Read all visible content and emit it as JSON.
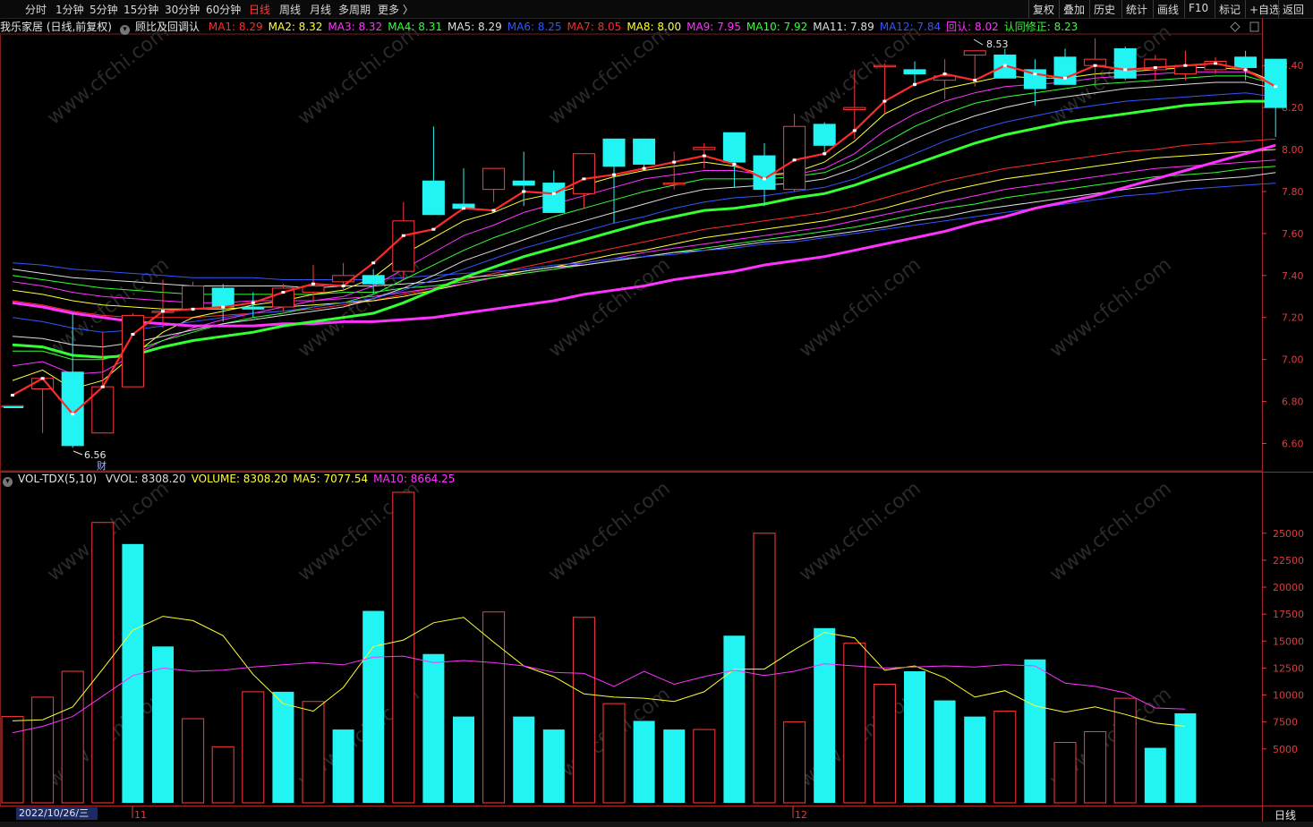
{
  "periods": [
    "分时",
    "1分钟",
    "5分钟",
    "15分钟",
    "30分钟",
    "60分钟",
    "日线",
    "周线",
    "月线",
    "多周期",
    "更多 〉"
  ],
  "active_period": "日线",
  "right_tools": [
    "复权",
    "叠加",
    "历史",
    "统计",
    "画线",
    "F10",
    "标记",
    "+自选",
    "返回"
  ],
  "main_indicator": {
    "stock": "我乐家居 (日线,前复权)",
    "formula": "顾比及回调认",
    "values": [
      {
        "label": "MA1: 8.29",
        "color": "#ff2b2b"
      },
      {
        "label": "MA2: 8.32",
        "color": "#ffff33"
      },
      {
        "label": "MA3: 8.32",
        "color": "#ff33ff"
      },
      {
        "label": "MA4: 8.31",
        "color": "#33ff33"
      },
      {
        "label": "MA5: 8.29",
        "color": "#dddddd"
      },
      {
        "label": "MA6: 8.25",
        "color": "#3355ff"
      },
      {
        "label": "MA7: 8.05",
        "color": "#ff2b2b"
      },
      {
        "label": "MA8: 8.00",
        "color": "#ffff33"
      },
      {
        "label": "MA9: 7.95",
        "color": "#ff33ff"
      },
      {
        "label": "MA10: 7.92",
        "color": "#33ff33"
      },
      {
        "label": "MA11: 7.89",
        "color": "#dddddd"
      },
      {
        "label": "MA12: 7.84",
        "color": "#3355ff"
      },
      {
        "label": "回认: 8.02",
        "color": "#ff33ff"
      },
      {
        "label": "认同修正: 8.23",
        "color": "#33ff33"
      }
    ]
  },
  "vol_indicator": {
    "name": "VOL-TDX(5,10)",
    "values": [
      {
        "label": "VVOL: 8308.20",
        "color": "#dddddd"
      },
      {
        "label": "VOLUME: 8308.20",
        "color": "#ffff33"
      },
      {
        "label": "MA5: 7077.54",
        "color": "#ffff33"
      },
      {
        "label": "MA10: 8664.25",
        "color": "#ff33ff"
      }
    ]
  },
  "annotations": {
    "high_mark": "8.53",
    "low_mark": "6.56",
    "fin_mark": "财"
  },
  "bottom": {
    "date": "2022/10/26/三",
    "month_marks": [
      "11",
      "12"
    ],
    "period": "日线"
  },
  "watermark": "www.cfchi.com",
  "colors": {
    "up": "#ff3b3b",
    "down": "#22f3f3",
    "axis": "#e03c3c"
  },
  "price_axis": [
    "8.40",
    "8.20",
    "8.00",
    "7.80",
    "7.60",
    "7.40",
    "7.20",
    "7.00",
    "6.80",
    "6.60"
  ],
  "vol_axis": [
    "25000",
    "22500",
    "20000",
    "17500",
    "15000",
    "12500",
    "10000",
    "7500",
    "5000"
  ],
  "candles": [
    [
      6.78,
      6.78,
      6.78,
      6.78
    ],
    [
      6.86,
      6.91,
      6.65,
      6.91
    ],
    [
      6.94,
      7.22,
      6.58,
      6.59
    ],
    [
      6.65,
      7.13,
      6.65,
      6.87
    ],
    [
      6.87,
      7.22,
      6.87,
      7.21
    ],
    [
      7.23,
      7.38,
      7.15,
      7.23
    ],
    [
      7.24,
      7.37,
      7.23,
      7.35
    ],
    [
      7.34,
      7.36,
      7.18,
      7.25
    ],
    [
      7.25,
      7.32,
      7.2,
      7.24
    ],
    [
      7.25,
      7.36,
      7.23,
      7.34
    ],
    [
      7.32,
      7.45,
      7.27,
      7.35
    ],
    [
      7.37,
      7.46,
      7.33,
      7.4
    ],
    [
      7.4,
      7.43,
      7.31,
      7.36
    ],
    [
      7.42,
      7.75,
      7.38,
      7.66
    ],
    [
      7.85,
      8.11,
      7.73,
      7.69
    ],
    [
      7.74,
      7.91,
      7.73,
      7.72
    ],
    [
      7.81,
      7.91,
      7.75,
      7.91
    ],
    [
      7.85,
      7.99,
      7.73,
      7.83
    ],
    [
      7.84,
      7.9,
      7.71,
      7.7
    ],
    [
      7.79,
      7.97,
      7.72,
      7.98
    ],
    [
      8.05,
      8.05,
      7.65,
      7.92
    ],
    [
      8.05,
      8.05,
      7.9,
      7.93
    ],
    [
      7.84,
      7.99,
      7.81,
      7.84
    ],
    [
      8.0,
      8.03,
      7.91,
      8.01
    ],
    [
      8.08,
      8.08,
      7.82,
      7.94
    ],
    [
      7.97,
      8.03,
      7.73,
      7.81
    ],
    [
      7.81,
      8.17,
      7.8,
      8.11
    ],
    [
      8.12,
      8.13,
      7.97,
      8.02
    ],
    [
      8.19,
      8.38,
      8.05,
      8.2
    ],
    [
      8.4,
      8.41,
      8.17,
      8.4
    ],
    [
      8.38,
      8.42,
      8.3,
      8.36
    ],
    [
      8.33,
      8.43,
      8.24,
      8.35
    ],
    [
      8.45,
      8.45,
      8.3,
      8.47
    ],
    [
      8.45,
      8.48,
      8.34,
      8.34
    ],
    [
      8.38,
      8.43,
      8.21,
      8.29
    ],
    [
      8.44,
      8.48,
      8.32,
      8.31
    ],
    [
      8.4,
      8.53,
      8.3,
      8.43
    ],
    [
      8.48,
      8.49,
      8.33,
      8.34
    ],
    [
      8.38,
      8.45,
      8.33,
      8.43
    ],
    [
      8.36,
      8.47,
      8.33,
      8.4
    ],
    [
      8.38,
      8.44,
      8.36,
      8.42
    ],
    [
      8.44,
      8.47,
      8.33,
      8.39
    ],
    [
      8.43,
      8.43,
      8.06,
      8.2
    ]
  ],
  "volume": [
    8000,
    9800,
    12200,
    26000,
    24000,
    14500,
    7800,
    5200,
    10300,
    10300,
    9400,
    6800,
    17800,
    28800,
    13800,
    8000,
    17700,
    8000,
    6800,
    17200,
    9200,
    7600,
    6800,
    6800,
    15500,
    25000,
    7500,
    16200,
    14800,
    11000,
    12200,
    9500,
    8000,
    8500,
    13300,
    5600,
    6600,
    9700,
    5100,
    8300
  ],
  "vol_ma5": [
    7600,
    7700,
    8900,
    12400,
    16000,
    17300,
    16900,
    15500,
    11900,
    9200,
    8500,
    10700,
    14500,
    15100,
    16700,
    17200,
    14900,
    12700,
    11700,
    10100,
    9800,
    9700,
    9400,
    10300,
    12400,
    12400,
    14200,
    15800,
    15300,
    12300,
    12700,
    11600,
    9800,
    10400,
    9000,
    8400,
    8900,
    8200,
    7400,
    7100
  ],
  "vol_ma10": [
    6500,
    7100,
    8000,
    9900,
    11800,
    12500,
    12200,
    12300,
    12600,
    12800,
    13000,
    12800,
    13500,
    13600,
    13000,
    13200,
    13000,
    12700,
    12100,
    12000,
    10800,
    12200,
    11000,
    11700,
    12300,
    11800,
    12200,
    12900,
    12700,
    12500,
    12600,
    12700,
    12600,
    12800,
    12700,
    11100,
    10800,
    10200,
    8800,
    8700
  ],
  "ma_fast": [
    {
      "color": "#ff2b2b",
      "width": 2.2,
      "values": [
        6.83,
        6.91,
        6.74,
        6.87,
        7.12,
        7.23,
        7.24,
        7.25,
        7.27,
        7.32,
        7.36,
        7.35,
        7.46,
        7.59,
        7.62,
        7.72,
        7.71,
        7.8,
        7.79,
        7.86,
        7.88,
        7.91,
        7.94,
        7.97,
        7.93,
        7.86,
        7.95,
        7.98,
        8.09,
        8.23,
        8.31,
        8.36,
        8.33,
        8.4,
        8.36,
        8.34,
        8.4,
        8.38,
        8.39,
        8.4,
        8.41,
        8.38,
        8.3
      ]
    },
    {
      "color": "#ffff33",
      "width": 1,
      "values": [
        6.9,
        6.95,
        6.86,
        6.9,
        7.02,
        7.13,
        7.2,
        7.23,
        7.26,
        7.28,
        7.31,
        7.33,
        7.39,
        7.5,
        7.58,
        7.66,
        7.7,
        7.76,
        7.79,
        7.83,
        7.87,
        7.9,
        7.92,
        7.94,
        7.92,
        7.88,
        7.89,
        7.94,
        8.04,
        8.17,
        8.24,
        8.29,
        8.32,
        8.35,
        8.34,
        8.34,
        8.36,
        8.37,
        8.38,
        8.39,
        8.39,
        8.38,
        8.32
      ]
    },
    {
      "color": "#ff33ff",
      "width": 1,
      "values": [
        6.97,
        6.99,
        6.93,
        6.94,
        7.02,
        7.09,
        7.15,
        7.19,
        7.22,
        7.25,
        7.28,
        7.3,
        7.35,
        7.43,
        7.51,
        7.59,
        7.64,
        7.7,
        7.74,
        7.78,
        7.82,
        7.86,
        7.88,
        7.9,
        7.9,
        7.88,
        7.88,
        7.91,
        7.98,
        8.09,
        8.17,
        8.23,
        8.27,
        8.3,
        8.31,
        8.32,
        8.34,
        8.35,
        8.36,
        8.37,
        8.37,
        8.37,
        8.32
      ]
    },
    {
      "color": "#33ff33",
      "width": 1,
      "values": [
        7.04,
        7.04,
        7.0,
        7.0,
        7.04,
        7.09,
        7.13,
        7.17,
        7.2,
        7.22,
        7.25,
        7.27,
        7.31,
        7.38,
        7.45,
        7.52,
        7.58,
        7.63,
        7.68,
        7.72,
        7.76,
        7.8,
        7.83,
        7.86,
        7.86,
        7.86,
        7.87,
        7.89,
        7.95,
        8.03,
        8.11,
        8.17,
        8.22,
        8.25,
        8.27,
        8.29,
        8.31,
        8.32,
        8.33,
        8.34,
        8.35,
        8.35,
        8.31
      ]
    },
    {
      "color": "#dddddd",
      "width": 1,
      "values": [
        7.11,
        7.1,
        7.07,
        7.06,
        7.08,
        7.11,
        7.14,
        7.17,
        7.19,
        7.21,
        7.23,
        7.25,
        7.29,
        7.34,
        7.4,
        7.47,
        7.52,
        7.57,
        7.62,
        7.66,
        7.7,
        7.74,
        7.78,
        7.81,
        7.82,
        7.83,
        7.84,
        7.86,
        7.91,
        7.98,
        8.05,
        8.11,
        8.16,
        8.2,
        8.23,
        8.25,
        8.27,
        8.29,
        8.3,
        8.31,
        8.32,
        8.32,
        8.29
      ]
    },
    {
      "color": "#3355ff",
      "width": 1,
      "values": [
        7.2,
        7.18,
        7.15,
        7.13,
        7.14,
        7.16,
        7.18,
        7.2,
        7.22,
        7.23,
        7.25,
        7.27,
        7.29,
        7.33,
        7.38,
        7.43,
        7.48,
        7.53,
        7.57,
        7.61,
        7.65,
        7.68,
        7.72,
        7.75,
        7.77,
        7.78,
        7.8,
        7.82,
        7.86,
        7.92,
        7.98,
        8.04,
        8.09,
        8.13,
        8.16,
        8.19,
        8.21,
        8.23,
        8.24,
        8.25,
        8.26,
        8.27,
        8.25
      ]
    }
  ],
  "ma_slow": [
    {
      "color": "#ff2b2b",
      "width": 1,
      "values": [
        7.28,
        7.26,
        7.23,
        7.21,
        7.2,
        7.2,
        7.2,
        7.21,
        7.22,
        7.23,
        7.24,
        7.26,
        7.28,
        7.31,
        7.34,
        7.38,
        7.41,
        7.44,
        7.47,
        7.5,
        7.53,
        7.56,
        7.59,
        7.62,
        7.64,
        7.66,
        7.68,
        7.7,
        7.73,
        7.77,
        7.81,
        7.85,
        7.88,
        7.91,
        7.93,
        7.95,
        7.97,
        7.99,
        8.0,
        8.02,
        8.03,
        8.04,
        8.05
      ]
    },
    {
      "color": "#ffff33",
      "width": 1,
      "values": [
        7.33,
        7.31,
        7.28,
        7.26,
        7.25,
        7.24,
        7.24,
        7.24,
        7.25,
        7.25,
        7.26,
        7.27,
        7.28,
        7.3,
        7.33,
        7.36,
        7.39,
        7.42,
        7.44,
        7.47,
        7.5,
        7.52,
        7.55,
        7.58,
        7.6,
        7.62,
        7.64,
        7.66,
        7.69,
        7.72,
        7.76,
        7.8,
        7.83,
        7.86,
        7.88,
        7.9,
        7.92,
        7.94,
        7.96,
        7.97,
        7.98,
        7.99,
        8.0
      ]
    },
    {
      "color": "#ff33ff",
      "width": 1,
      "values": [
        7.37,
        7.35,
        7.32,
        7.3,
        7.29,
        7.28,
        7.27,
        7.27,
        7.28,
        7.28,
        7.28,
        7.29,
        7.3,
        7.32,
        7.34,
        7.36,
        7.39,
        7.41,
        7.43,
        7.46,
        7.48,
        7.51,
        7.53,
        7.55,
        7.57,
        7.59,
        7.61,
        7.63,
        7.66,
        7.69,
        7.72,
        7.75,
        7.78,
        7.81,
        7.83,
        7.85,
        7.87,
        7.89,
        7.91,
        7.92,
        7.93,
        7.94,
        7.95
      ]
    },
    {
      "color": "#33ff33",
      "width": 1,
      "values": [
        7.4,
        7.38,
        7.36,
        7.34,
        7.33,
        7.32,
        7.31,
        7.31,
        7.31,
        7.31,
        7.31,
        7.32,
        7.32,
        7.34,
        7.35,
        7.37,
        7.39,
        7.41,
        7.43,
        7.45,
        7.47,
        7.49,
        7.51,
        7.53,
        7.55,
        7.57,
        7.59,
        7.61,
        7.63,
        7.66,
        7.69,
        7.72,
        7.74,
        7.77,
        7.79,
        7.81,
        7.83,
        7.85,
        7.87,
        7.88,
        7.89,
        7.91,
        7.92
      ]
    },
    {
      "color": "#dddddd",
      "width": 1,
      "values": [
        7.43,
        7.41,
        7.39,
        7.38,
        7.37,
        7.36,
        7.35,
        7.35,
        7.35,
        7.35,
        7.34,
        7.35,
        7.35,
        7.36,
        7.37,
        7.39,
        7.4,
        7.42,
        7.44,
        7.45,
        7.47,
        7.49,
        7.51,
        7.52,
        7.54,
        7.56,
        7.57,
        7.59,
        7.61,
        7.63,
        7.66,
        7.68,
        7.71,
        7.73,
        7.75,
        7.77,
        7.79,
        7.81,
        7.83,
        7.85,
        7.86,
        7.87,
        7.89
      ]
    },
    {
      "color": "#3355ff",
      "width": 1,
      "values": [
        7.46,
        7.45,
        7.43,
        7.42,
        7.41,
        7.4,
        7.39,
        7.39,
        7.39,
        7.38,
        7.38,
        7.38,
        7.38,
        7.39,
        7.4,
        7.41,
        7.42,
        7.43,
        7.45,
        7.46,
        7.48,
        7.49,
        7.5,
        7.52,
        7.53,
        7.55,
        7.56,
        7.58,
        7.6,
        7.62,
        7.64,
        7.66,
        7.68,
        7.7,
        7.72,
        7.74,
        7.76,
        7.78,
        7.79,
        7.81,
        7.82,
        7.83,
        7.84
      ]
    }
  ],
  "line_huiren": {
    "color": "#ff33ff",
    "width": 3,
    "values": [
      7.27,
      7.25,
      7.22,
      7.2,
      7.18,
      7.17,
      7.16,
      7.16,
      7.16,
      7.17,
      7.17,
      7.18,
      7.18,
      7.19,
      7.2,
      7.22,
      7.24,
      7.26,
      7.28,
      7.31,
      7.33,
      7.35,
      7.38,
      7.4,
      7.42,
      7.45,
      7.47,
      7.49,
      7.52,
      7.55,
      7.58,
      7.61,
      7.65,
      7.68,
      7.72,
      7.75,
      7.78,
      7.82,
      7.86,
      7.9,
      7.94,
      7.98,
      8.02
    ]
  },
  "line_rentong": {
    "color": "#33ff33",
    "width": 3,
    "values": [
      7.07,
      7.06,
      7.02,
      7.01,
      7.02,
      7.06,
      7.09,
      7.11,
      7.13,
      7.16,
      7.18,
      7.2,
      7.22,
      7.27,
      7.33,
      7.39,
      7.44,
      7.49,
      7.53,
      7.57,
      7.61,
      7.65,
      7.68,
      7.71,
      7.72,
      7.74,
      7.77,
      7.79,
      7.83,
      7.88,
      7.93,
      7.98,
      8.03,
      8.07,
      8.1,
      8.13,
      8.15,
      8.17,
      8.19,
      8.21,
      8.22,
      8.23,
      8.23
    ]
  }
}
